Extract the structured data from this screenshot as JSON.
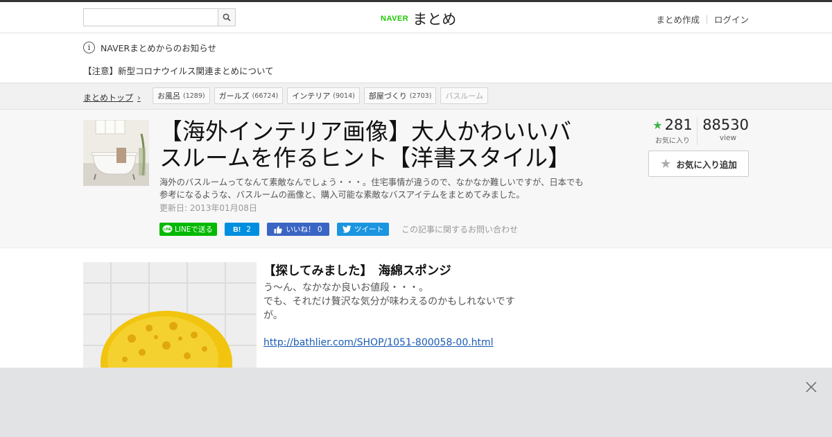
{
  "header": {
    "search_placeholder": "",
    "logo_brand": "NAVER",
    "logo_name": "まとめ",
    "nav": [
      "まとめ作成",
      "ログイン"
    ]
  },
  "notice": {
    "heading": "NAVERまとめからのお知らせ",
    "link": "【注意】新型コロナウイルス関連まとめについて"
  },
  "breadcrumb": {
    "top": "まとめトップ",
    "tags": [
      {
        "label": "お風呂",
        "count": "(1289)"
      },
      {
        "label": "ガールズ",
        "count": "(66724)"
      },
      {
        "label": "インテリア",
        "count": "(9014)"
      },
      {
        "label": "部屋づくり",
        "count": "(2703)"
      },
      {
        "label": "バスルーム",
        "count": ""
      }
    ]
  },
  "article": {
    "title": "【海外インテリア画像】大人かわいいバスルームを作るヒント【洋書スタイル】",
    "description": "海外のバスルームってなんて素敵なんでしょう・・・。住宅事情が違うので、なかなか難しいですが、日本でも参考になるような、バスルームの画像と、購入可能な素敵なバスアイテムをまとめてみました。",
    "updated": "更新日: 2013年01月08日",
    "share": {
      "line": "LINEで送る",
      "hatena_count": "2",
      "facebook": "いいね！ 0",
      "twitter": "ツイート",
      "inquiry": "この記事に関するお問い合わせ"
    },
    "favorites": "281",
    "favorites_label": "お気に入り",
    "views": "88530",
    "views_label": "view",
    "fav_add": "お気に入り追加"
  },
  "item": {
    "title": "【探してみました】　海綿スポンジ",
    "body": "う～ん、なかなか良いお値段・・・。\nでも、それだけ贅沢な気分が味わえるのかもしれないですが。",
    "link": "http://bathlier.com/SHOP/1051-800058-00.html"
  },
  "colors": {
    "naver_green": "#1ec800",
    "star_green": "#3cb44b",
    "line_green": "#00b900",
    "hatena_blue": "#008fde",
    "facebook_blue": "#3b65c4",
    "twitter_blue": "#1b95e0",
    "link_blue": "#1a5bb5"
  }
}
